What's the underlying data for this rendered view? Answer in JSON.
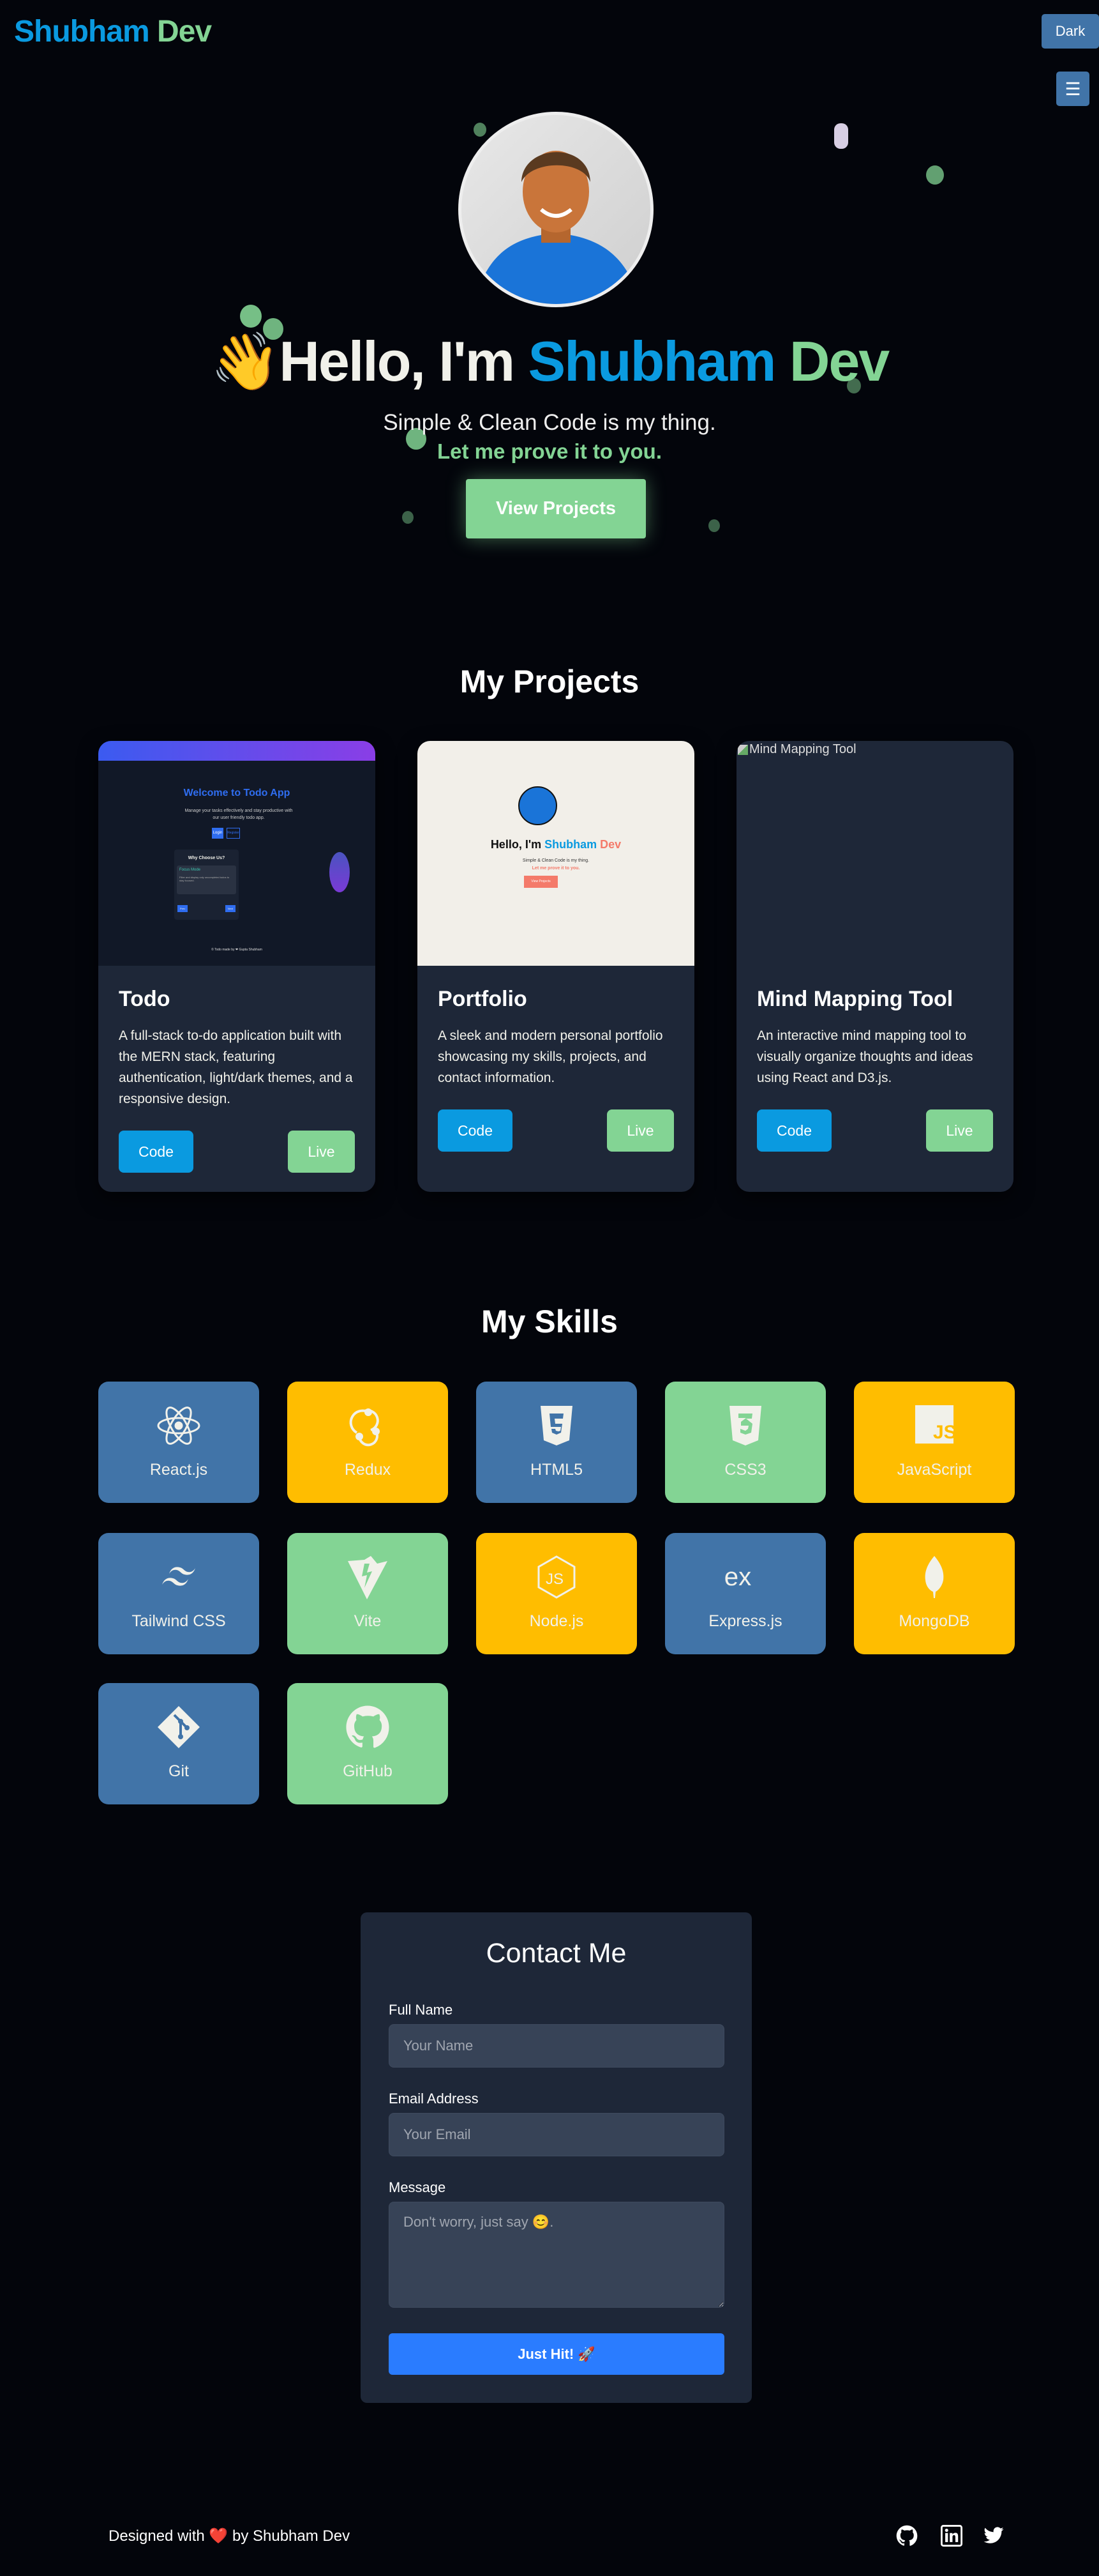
{
  "header": {
    "logo_first": "Shubham",
    "logo_second": "Dev",
    "theme_button": "Dark",
    "menu_icon": "☰"
  },
  "hero": {
    "wave": "👋",
    "greeting": "Hello, I'm",
    "name_first": "Shubham",
    "name_second": "Dev",
    "subtitle": "Simple & Clean Code is my thing.",
    "tagline": "Let me prove it to you.",
    "cta": "View Projects"
  },
  "projects": {
    "title": "My Projects",
    "items": [
      {
        "title": "Todo",
        "description": "A full-stack to-do application built with the MERN stack, featuring authentication, light/dark themes, and a responsive design.",
        "code": "Code",
        "live": "Live",
        "preview": {
          "heading": "Welcome to Todo App",
          "text": "Manage your tasks effectively and stay productive with our user friendly todo app.",
          "login": "Login",
          "register": "Register",
          "why": "Why Choose Us?",
          "feature": "Focus Mode",
          "feature_text": "Filter and display only uncompleted todos to stay focused.",
          "prev": "Prev",
          "next": "Next",
          "footer": "© Todo made by ❤ Gupta Shubham"
        }
      },
      {
        "title": "Portfolio",
        "description": "A sleek and modern personal portfolio showcasing my skills, projects, and contact information.",
        "code": "Code",
        "live": "Live",
        "preview": {
          "greeting": "Hello, I'm",
          "name_first": "Shubham",
          "name_second": "Dev",
          "subtitle": "Simple & Clean Code is my thing.",
          "tagline": "Let me prove it to you.",
          "cta": "View Projects"
        }
      },
      {
        "title": "Mind Mapping Tool",
        "description": "An interactive mind mapping tool to visually organize thoughts and ideas using React and D3.js.",
        "code": "Code",
        "live": "Live",
        "image_alt": "Mind Mapping Tool"
      }
    ]
  },
  "skills": {
    "title": "My Skills",
    "items": [
      {
        "label": "React.js",
        "icon": "react-icon",
        "color": "#4174a8"
      },
      {
        "label": "Redux",
        "icon": "redux-icon",
        "color": "#ffbd00"
      },
      {
        "label": "HTML5",
        "icon": "html5-icon",
        "color": "#4174a8"
      },
      {
        "label": "CSS3",
        "icon": "css3-icon",
        "color": "#83d494"
      },
      {
        "label": "JavaScript",
        "icon": "javascript-icon",
        "color": "#ffbd00"
      },
      {
        "label": "Tailwind CSS",
        "icon": "tailwind-icon",
        "color": "#4174a8"
      },
      {
        "label": "Vite",
        "icon": "vite-icon",
        "color": "#83d494"
      },
      {
        "label": "Node.js",
        "icon": "nodejs-icon",
        "color": "#ffbd00"
      },
      {
        "label": "Express.js",
        "icon": "express-icon",
        "color": "#4174a8"
      },
      {
        "label": "MongoDB",
        "icon": "mongodb-icon",
        "color": "#ffbd00"
      },
      {
        "label": "Git",
        "icon": "git-icon",
        "color": "#4174a8"
      },
      {
        "label": "GitHub",
        "icon": "github-icon",
        "color": "#83d494"
      }
    ]
  },
  "contact": {
    "title": "Contact Me",
    "name_label": "Full Name",
    "name_placeholder": "Your Name",
    "email_label": "Email Address",
    "email_placeholder": "Your Email",
    "message_label": "Message",
    "message_placeholder": "Don't worry, just say 😊.",
    "submit": "Just Hit! 🚀"
  },
  "footer": {
    "text_before": "Designed with",
    "heart": "❤️",
    "text_after": "by Shubham Dev"
  },
  "colors": {
    "accent_blue": "#0a9ae0",
    "accent_green": "#83d494",
    "tile_blue": "#4174a8",
    "tile_yellow": "#ffbd00",
    "card_bg": "#1e2738",
    "submit_blue": "#2a7cff"
  }
}
